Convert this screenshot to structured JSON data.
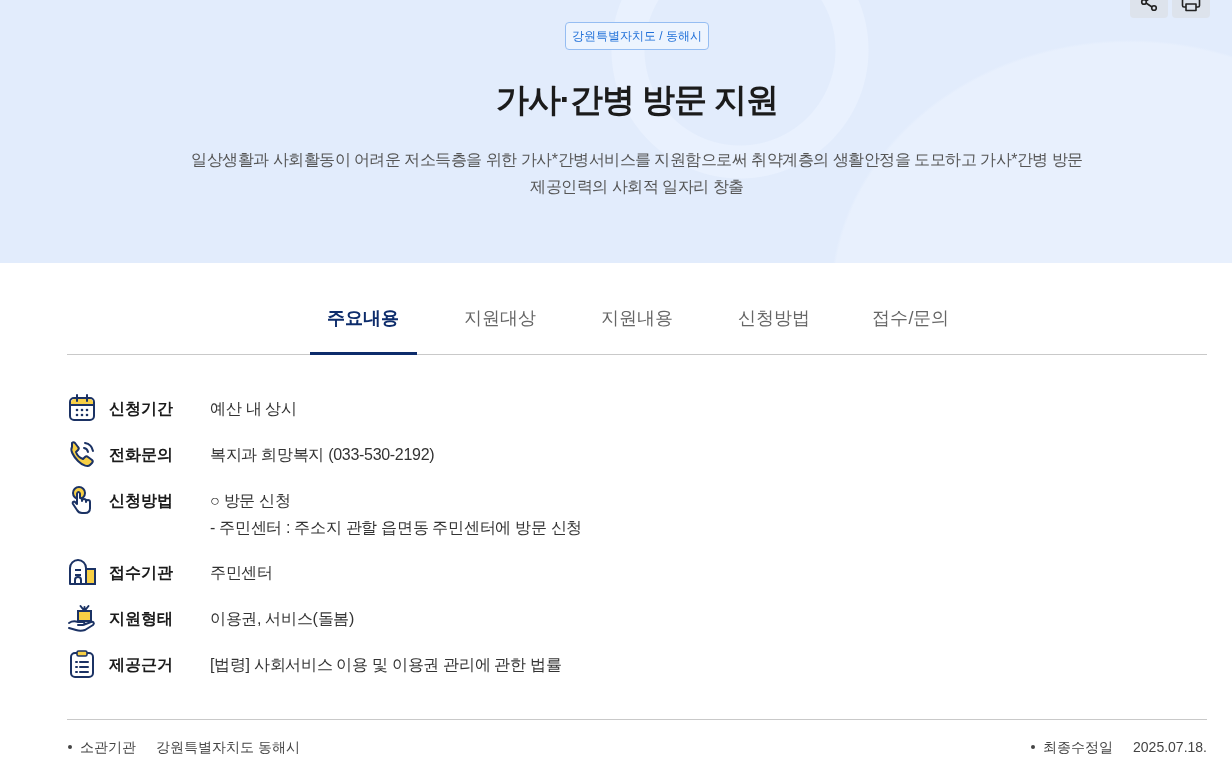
{
  "header": {
    "region_badge": "강원특별자치도 / 동해시",
    "title": "가사·간병 방문 지원",
    "description": "일상생활과 사회활동이 어려운 저소득층을 위한 가사*간병서비스를 지원함으로써 취약계층의 생활안정을 도모하고 가사*간병 방문 제공인력의 사회적 일자리 창출"
  },
  "tabs": [
    {
      "label": "주요내용",
      "selected": true
    },
    {
      "label": "지원대상",
      "selected": false
    },
    {
      "label": "지원내용",
      "selected": false
    },
    {
      "label": "신청방법",
      "selected": false
    },
    {
      "label": "접수/문의",
      "selected": false
    }
  ],
  "details": [
    {
      "label": "신청기간",
      "lines": [
        "예산 내 상시"
      ]
    },
    {
      "label": "전화문의",
      "lines": [
        "복지과 희망복지 (033-530-2192)"
      ]
    },
    {
      "label": "신청방법",
      "lines": [
        "○ 방문 신청",
        "- 주민센터 : 주소지 관할 읍면동 주민센터에 방문 신청"
      ]
    },
    {
      "label": "접수기관",
      "lines": [
        "주민센터"
      ]
    },
    {
      "label": "지원형태",
      "lines": [
        "이용권, 서비스(돌봄)"
      ]
    },
    {
      "label": "제공근거",
      "lines": [
        "[법령] 사회서비스 이용 및 이용권 관리에 관한 법률"
      ]
    }
  ],
  "footer": {
    "left": {
      "label": "소관기관",
      "value": "강원특별자치도 동해시"
    },
    "right": {
      "label": "최종수정일",
      "value": "2025.07.18."
    }
  }
}
